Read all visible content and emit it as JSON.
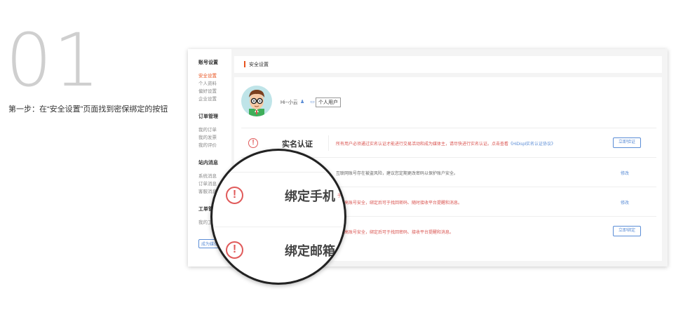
{
  "step": {
    "number": "01",
    "description": "第一步：在“安全设置”页面找到密保绑定的按钮"
  },
  "sidebar": {
    "groups": [
      {
        "title": "账号设置",
        "items": [
          {
            "label": "安全设置",
            "active": true
          },
          {
            "label": "个人资料",
            "active": false
          },
          {
            "label": "偏好设置",
            "active": false
          },
          {
            "label": "企业设置",
            "active": false
          }
        ]
      },
      {
        "title": "订单管理",
        "items": [
          {
            "label": "我的订单",
            "active": false
          },
          {
            "label": "我的发票",
            "active": false
          },
          {
            "label": "我的评价",
            "active": false
          }
        ]
      },
      {
        "title": "站内消息",
        "items": [
          {
            "label": "系统消息",
            "active": false
          },
          {
            "label": "订单消息",
            "active": false
          },
          {
            "label": "客服消息",
            "active": false
          }
        ]
      },
      {
        "title": "工单管理",
        "items": [
          {
            "label": "我的工单",
            "active": false
          }
        ]
      }
    ],
    "become_button": "成为媒体主"
  },
  "header": {
    "title": "安全设置"
  },
  "user": {
    "name": "Hi~小云",
    "icons": "♟ ▭",
    "tag": "个人用户"
  },
  "security_rows": [
    {
      "title": "实名认证",
      "desc": "所有用户必须通过实名认证才能进行交易活动和成为媒体主，请尽快进行实名认证。点击查看",
      "link": "《HiDispl实名认证协议》",
      "desc_color": "red",
      "action": "立即验证",
      "action_type": "button"
    },
    {
      "title": "",
      "desc": "互联网账号存在被盗风险，建议您定期更改密码以保护账户安全。",
      "link": "",
      "desc_color": "gray",
      "action": "修改",
      "action_type": "link"
    },
    {
      "title": "",
      "desc": "于提高账号安全，绑定后可于找回密码、随时接收平台提醒和消息。",
      "link": "",
      "desc_color": "red",
      "action": "修改",
      "action_type": "link"
    },
    {
      "title": "",
      "desc": "于提高账号安全，绑定后可于找回密码、接收平台提醒和消息。",
      "link": "",
      "desc_color": "red",
      "action": "立即绑定",
      "action_type": "button"
    }
  ],
  "magnifier": {
    "rows": [
      {
        "icon": "!",
        "title": "绑定手机",
        "desc": "于提高账号安全，绑定后可于找回密码、随时接收平台提醒和消息。"
      },
      {
        "icon": "!",
        "title": "绑定邮箱",
        "desc": "于提高账号安全，绑定后可于找回密码、接收平台提醒和消息。"
      }
    ]
  },
  "colors": {
    "accent": "#e8531f",
    "link_blue": "#5b8dd6",
    "warning_red": "#e05a5a",
    "step_gray": "#cfcfcf"
  },
  "icons": {
    "warning": "exclamation-circle-icon",
    "user": "user-icon",
    "id_card": "id-card-icon"
  }
}
